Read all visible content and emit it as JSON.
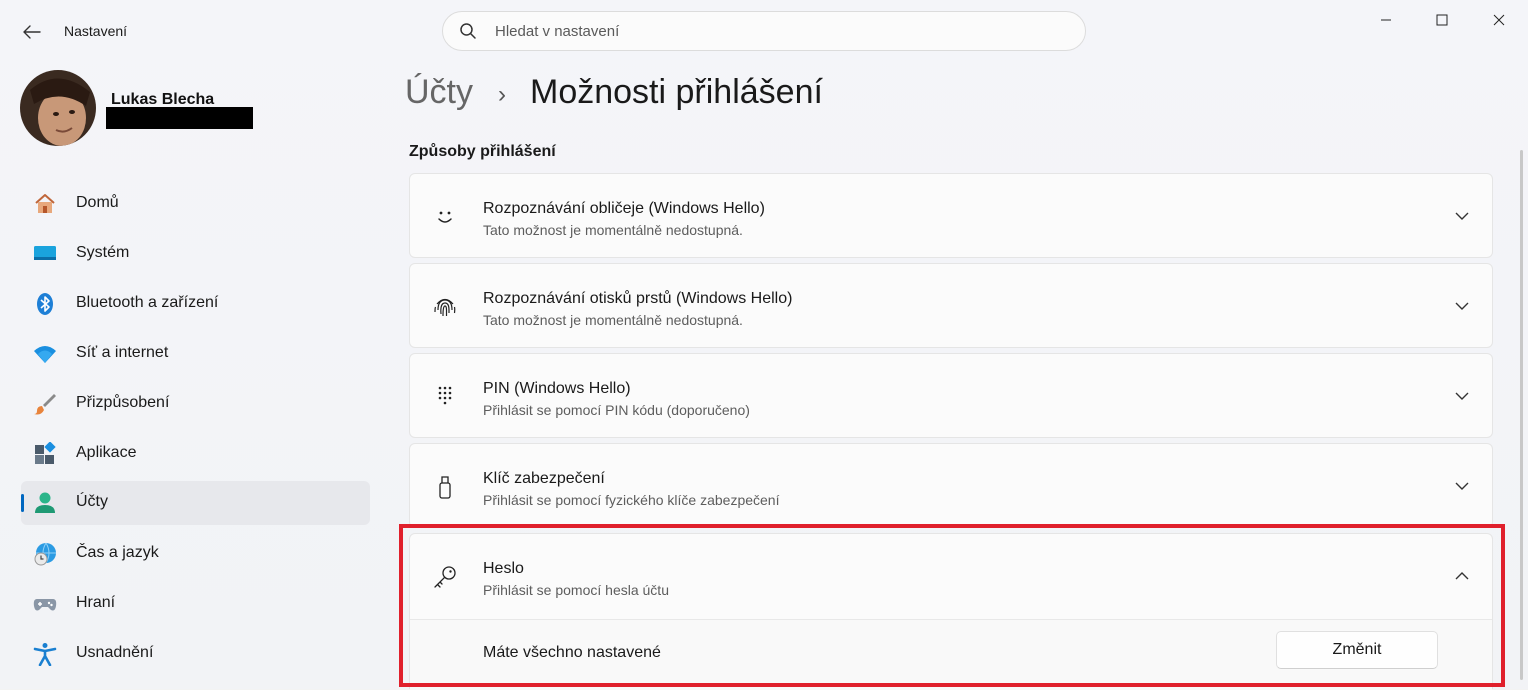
{
  "window": {
    "title": "Nastavení",
    "controls": {
      "minimize": "minimize",
      "maximize": "maximize",
      "close": "close"
    }
  },
  "search": {
    "placeholder": "Hledat v nastavení",
    "value": ""
  },
  "profile": {
    "name": "Lukas Blecha"
  },
  "sidebar": {
    "items": [
      {
        "label": "Domů",
        "icon": "home-icon"
      },
      {
        "label": "Systém",
        "icon": "system-icon"
      },
      {
        "label": "Bluetooth a zařízení",
        "icon": "bluetooth-icon"
      },
      {
        "label": "Síť a internet",
        "icon": "wifi-icon"
      },
      {
        "label": "Přizpůsobení",
        "icon": "brush-icon"
      },
      {
        "label": "Aplikace",
        "icon": "apps-icon"
      },
      {
        "label": "Účty",
        "icon": "accounts-icon",
        "active": true
      },
      {
        "label": "Čas a jazyk",
        "icon": "clock-globe-icon"
      },
      {
        "label": "Hraní",
        "icon": "gamepad-icon"
      },
      {
        "label": "Usnadnění",
        "icon": "accessibility-icon"
      }
    ]
  },
  "breadcrumb": {
    "parent": "Účty",
    "separator": "›",
    "current": "Možnosti přihlášení"
  },
  "section": {
    "title": "Způsoby přihlášení"
  },
  "options": [
    {
      "title": "Rozpoznávání obličeje (Windows Hello)",
      "subtitle": "Tato možnost je momentálně nedostupná.",
      "icon": "face-icon",
      "expanded": false
    },
    {
      "title": "Rozpoznávání otisků prstů (Windows Hello)",
      "subtitle": "Tato možnost je momentálně nedostupná.",
      "icon": "fingerprint-icon",
      "expanded": false
    },
    {
      "title": "PIN (Windows Hello)",
      "subtitle": "Přihlásit se pomocí PIN kódu (doporučeno)",
      "icon": "keypad-icon",
      "expanded": false
    },
    {
      "title": "Klíč zabezpečení",
      "subtitle": "Přihlásit se pomocí fyzického klíče zabezpečení",
      "icon": "usb-key-icon",
      "expanded": false
    },
    {
      "title": "Heslo",
      "subtitle": "Přihlásit se pomocí hesla účtu",
      "icon": "key-icon",
      "expanded": true
    }
  ],
  "password_panel": {
    "status": "Máte všechno nastavené",
    "button": "Změnit"
  },
  "colors": {
    "accent": "#0067c0",
    "highlight": "#e0202c"
  }
}
